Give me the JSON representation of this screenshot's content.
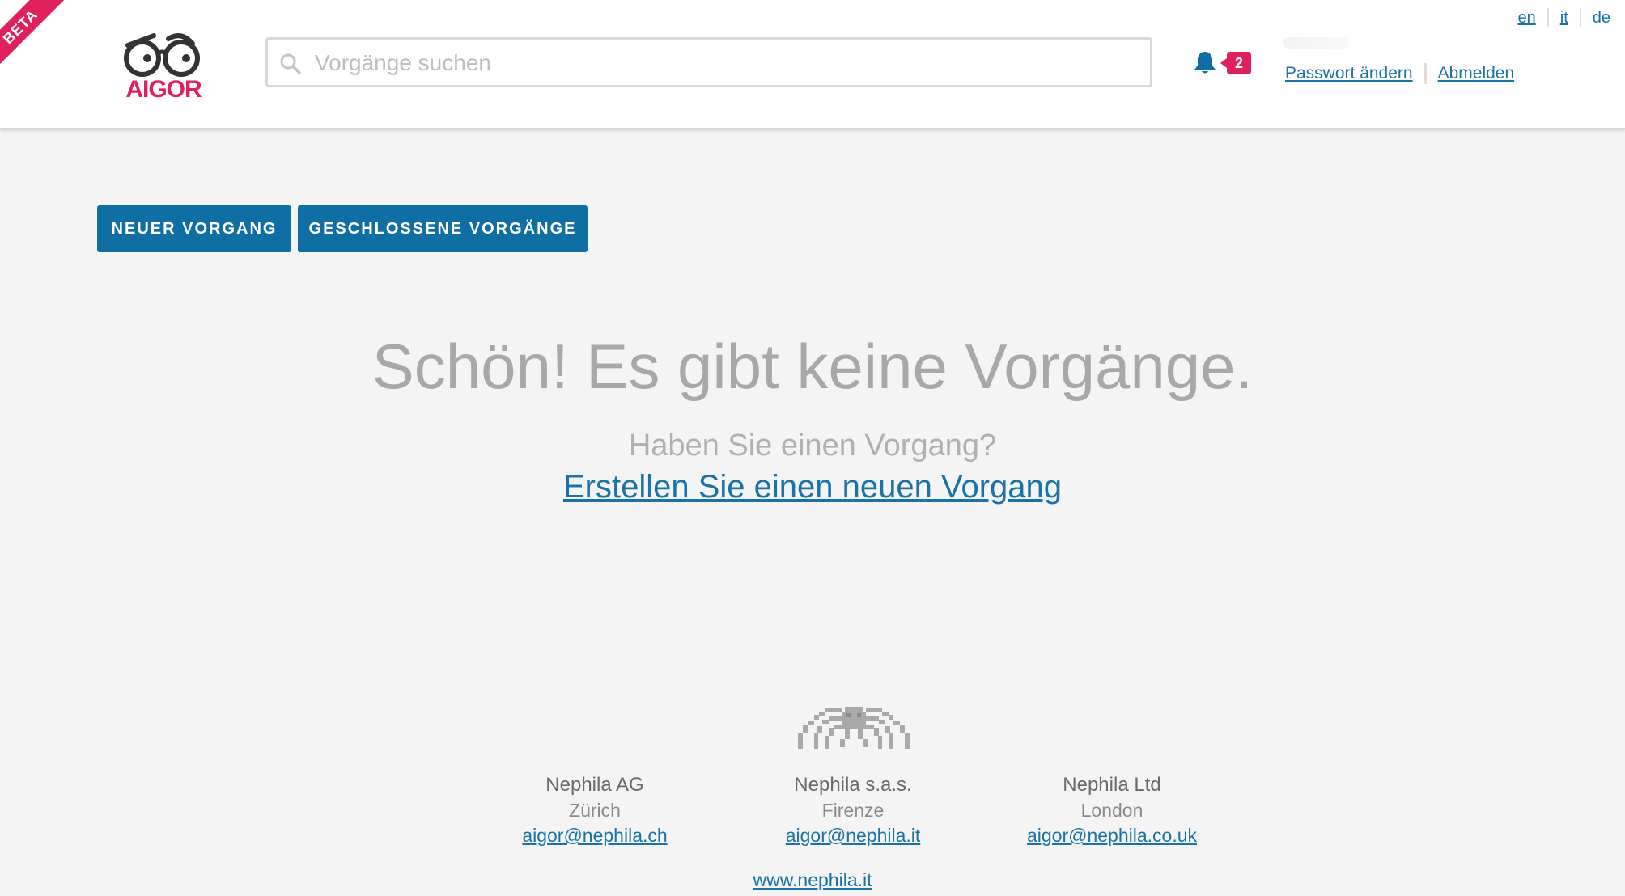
{
  "header": {
    "beta_label": "BETA",
    "logo_text": "AIGOR",
    "search_placeholder": "Vorgänge suchen",
    "notification_count": "2",
    "languages": [
      {
        "code": "en"
      },
      {
        "code": "it"
      },
      {
        "code": "de"
      }
    ],
    "user_links": {
      "change_password": "Passwort ändern",
      "logout": "Abmelden"
    }
  },
  "actions": {
    "new_case": "NEUER VORGANG",
    "closed_cases": "GESCHLOSSENE VORGÄNGE"
  },
  "empty_state": {
    "title": "Schön! Es gibt keine Vorgänge.",
    "question": "Haben Sie einen Vorgang?",
    "link": "Erstellen Sie einen neuen Vorgang"
  },
  "footer": {
    "offices": [
      {
        "name": "Nephila AG",
        "city": "Zürich",
        "email": "aigor@nephila.ch"
      },
      {
        "name": "Nephila s.a.s.",
        "city": "Firenze",
        "email": "aigor@nephila.it"
      },
      {
        "name": "Nephila Ltd",
        "city": "London",
        "email": "aigor@nephila.co.uk"
      }
    ],
    "website": "www.nephila.it"
  },
  "colors": {
    "brand_red": "#e0205a",
    "primary_blue": "#0f6ea4",
    "link_blue": "#1a73a8",
    "background": "#f4f4f4"
  }
}
